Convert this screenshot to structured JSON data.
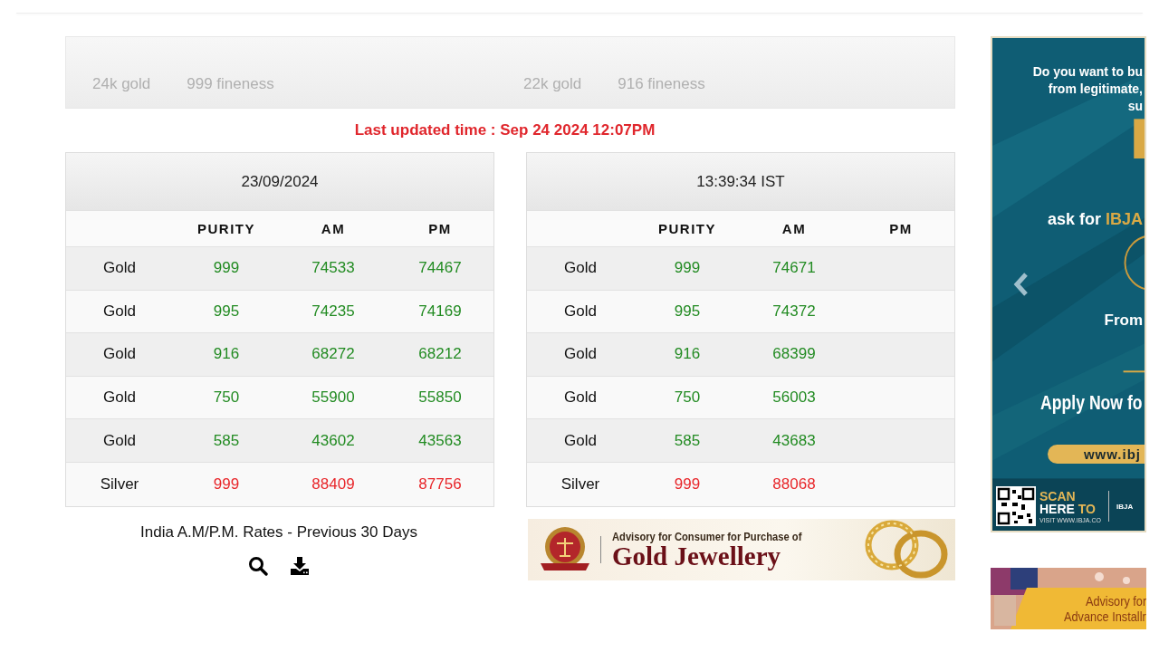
{
  "top_rates": [
    {
      "label": "24k gold",
      "fineness": "999 fineness"
    },
    {
      "label": "22k gold",
      "fineness": "916 fineness"
    }
  ],
  "last_updated": "Last updated time : Sep 24 2024 12:07PM",
  "tables": [
    {
      "heading": "23/09/2024",
      "columns": [
        "PURITY",
        "AM",
        "PM"
      ],
      "rows": [
        {
          "metal": "Gold",
          "purity": "999",
          "am": "74533",
          "pm": "74467",
          "color": "#228b22"
        },
        {
          "metal": "Gold",
          "purity": "995",
          "am": "74235",
          "pm": "74169",
          "color": "#228b22"
        },
        {
          "metal": "Gold",
          "purity": "916",
          "am": "68272",
          "pm": "68212",
          "color": "#228b22"
        },
        {
          "metal": "Gold",
          "purity": "750",
          "am": "55900",
          "pm": "55850",
          "color": "#228b22"
        },
        {
          "metal": "Gold",
          "purity": "585",
          "am": "43602",
          "pm": "43563",
          "color": "#228b22"
        },
        {
          "metal": "Silver",
          "purity": "999",
          "am": "88409",
          "pm": "87756",
          "color": "#e8262a"
        }
      ]
    },
    {
      "heading": "13:39:34 IST",
      "columns": [
        "PURITY",
        "AM",
        "PM"
      ],
      "rows": [
        {
          "metal": "Gold",
          "purity": "999",
          "am": "74671",
          "color": "#228b22"
        },
        {
          "metal": "Gold",
          "purity": "995",
          "am": "74372",
          "color": "#228b22"
        },
        {
          "metal": "Gold",
          "purity": "916",
          "am": "68399",
          "color": "#228b22"
        },
        {
          "metal": "Gold",
          "purity": "750",
          "am": "56003",
          "color": "#228b22"
        },
        {
          "metal": "Gold",
          "purity": "585",
          "am": "43683",
          "color": "#228b22"
        },
        {
          "metal": "Silver",
          "purity": "999",
          "am": "88068",
          "color": "#e8262a"
        }
      ]
    }
  ],
  "history": {
    "caption": "India A.M/P.M. Rates - Previous 30 Days"
  },
  "advisory_banner": {
    "title": "Advisory for Consumer for Purchase of",
    "headline": "Gold Jewellery"
  },
  "side_banner": {
    "lines": [
      "Do you want to bu",
      "from legitimate,",
      "su"
    ],
    "ask": "ask for",
    "brand": "IBJA",
    "from": "From",
    "apply": "Apply Now fo",
    "url": "www.ibj",
    "scan": "SCAN",
    "here": "HERE",
    "to": "TO",
    "visit": "VISIT WWW.IBJA.CO",
    "tag": "IBJA"
  },
  "bottom_banner": {
    "lines": [
      "Advisory for",
      "Advance Installr"
    ]
  }
}
